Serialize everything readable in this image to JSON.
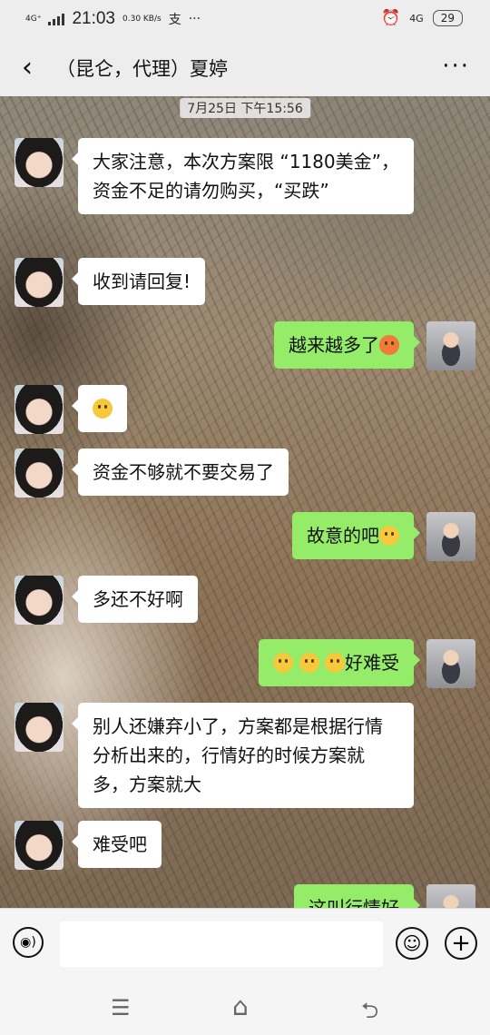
{
  "status": {
    "network": "4G⁺",
    "time": "21:03",
    "speed": "0.30 KB/s",
    "alipay": "支",
    "more_dots": "···",
    "net_right": "4G",
    "battery": "29"
  },
  "header": {
    "back": "‹",
    "title": "（昆仑，代理）夏婷",
    "more": "···"
  },
  "chat": {
    "timestamp": "7月25日 下午15:56",
    "messages": [
      {
        "from": "her",
        "text": "大家注意，本次方案限 “1180美金”，资金不足的请勿购买，“买跌”"
      },
      {
        "from": "her",
        "text": "收到请回复!"
      },
      {
        "from": "me",
        "text": "越来越多了",
        "emoji": "angry-face"
      },
      {
        "from": "her",
        "text": "",
        "emoji": "grin-face"
      },
      {
        "from": "her",
        "text": "资金不够就不要交易了"
      },
      {
        "from": "me",
        "text": "故意的吧",
        "emoji": "crying-face"
      },
      {
        "from": "her",
        "text": "多还不好啊"
      },
      {
        "from": "me",
        "text": "好难受",
        "emoji": "pleading-face"
      },
      {
        "from": "her",
        "text": "别人还嫌弃小了，方案都是根据行情分析出来的，行情好的时候方案就多，方案就大"
      },
      {
        "from": "her",
        "text": "难受吧"
      },
      {
        "from": "me",
        "text": "这叫行情好"
      }
    ]
  },
  "input": {
    "voice": "◉)",
    "emoji": "☺",
    "plus": "+"
  },
  "nav": {
    "menu": "☰",
    "home": "⌂",
    "back": "⮌"
  },
  "colors": {
    "out_bubble": "#95ec69",
    "in_bubble": "#ffffff",
    "bar": "#ededed"
  }
}
